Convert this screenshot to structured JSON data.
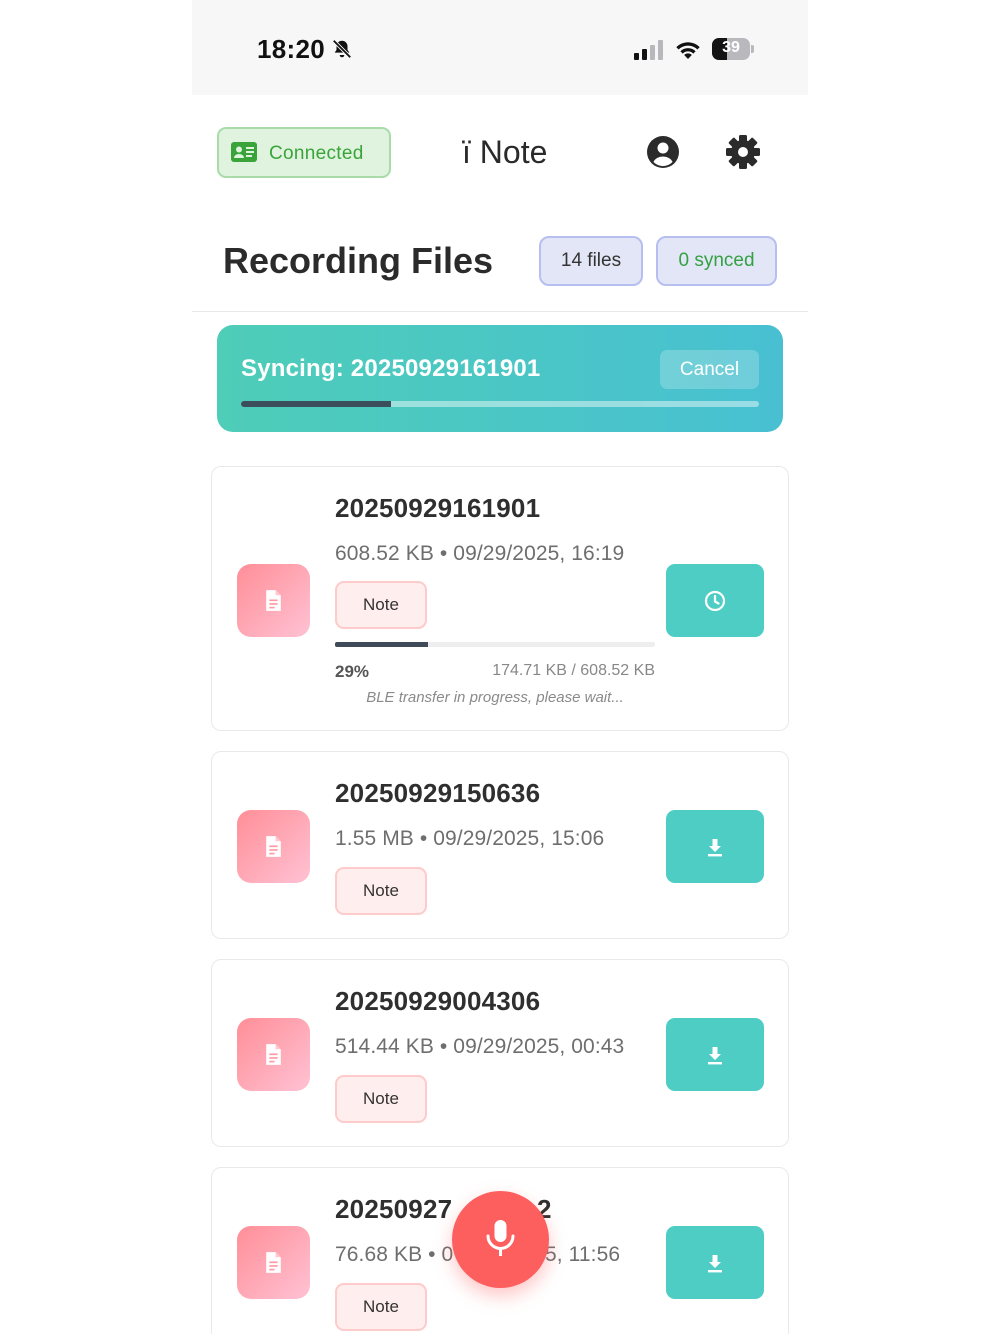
{
  "status_bar": {
    "time": "18:20",
    "battery": "39",
    "battery_level": 0.39,
    "icons": [
      "bell-slash-icon",
      "cellular-signal-icon",
      "wifi-icon",
      "battery-icon"
    ]
  },
  "header": {
    "connection_label": "Connected",
    "app_name": "ï Note",
    "icons": [
      "id-card-icon",
      "account-icon",
      "settings-gear-icon"
    ]
  },
  "files_section": {
    "title": "Recording Files",
    "files_count": "14 files",
    "synced_count": "0 synced"
  },
  "sync_banner": {
    "label": "Syncing: 20250929161901",
    "cancel_label": "Cancel",
    "progress": 0.29
  },
  "files": [
    {
      "name": "20250929161901",
      "meta": "608.52 KB • 09/29/2025, 16:19",
      "tag": "Note",
      "action_icon": "clock-icon",
      "progress": {
        "fraction": 0.29,
        "percent": "29%",
        "bytes": "174.71 KB / 608.52 KB",
        "message": "BLE transfer in progress, please wait..."
      }
    },
    {
      "name": "20250929150636",
      "meta": "1.55 MB • 09/29/2025, 15:06",
      "tag": "Note",
      "action_icon": "download-icon"
    },
    {
      "name": "20250929004306",
      "meta": "514.44 KB • 09/29/2025, 00:43",
      "tag": "Note",
      "action_icon": "download-icon"
    },
    {
      "name": "20250927",
      "name_end": "2",
      "meta": "76.68 KB • 0",
      "meta_end": "5, 11:56",
      "tag": "Note",
      "action_icon": "download-icon"
    }
  ],
  "fab": {
    "icon": "microphone-icon"
  },
  "colors": {
    "accent_teal": "#4ecdc4",
    "record_red": "#fd5f5f",
    "connected_green": "#3aa43a",
    "file_icon_pink": "#ff8e97"
  }
}
